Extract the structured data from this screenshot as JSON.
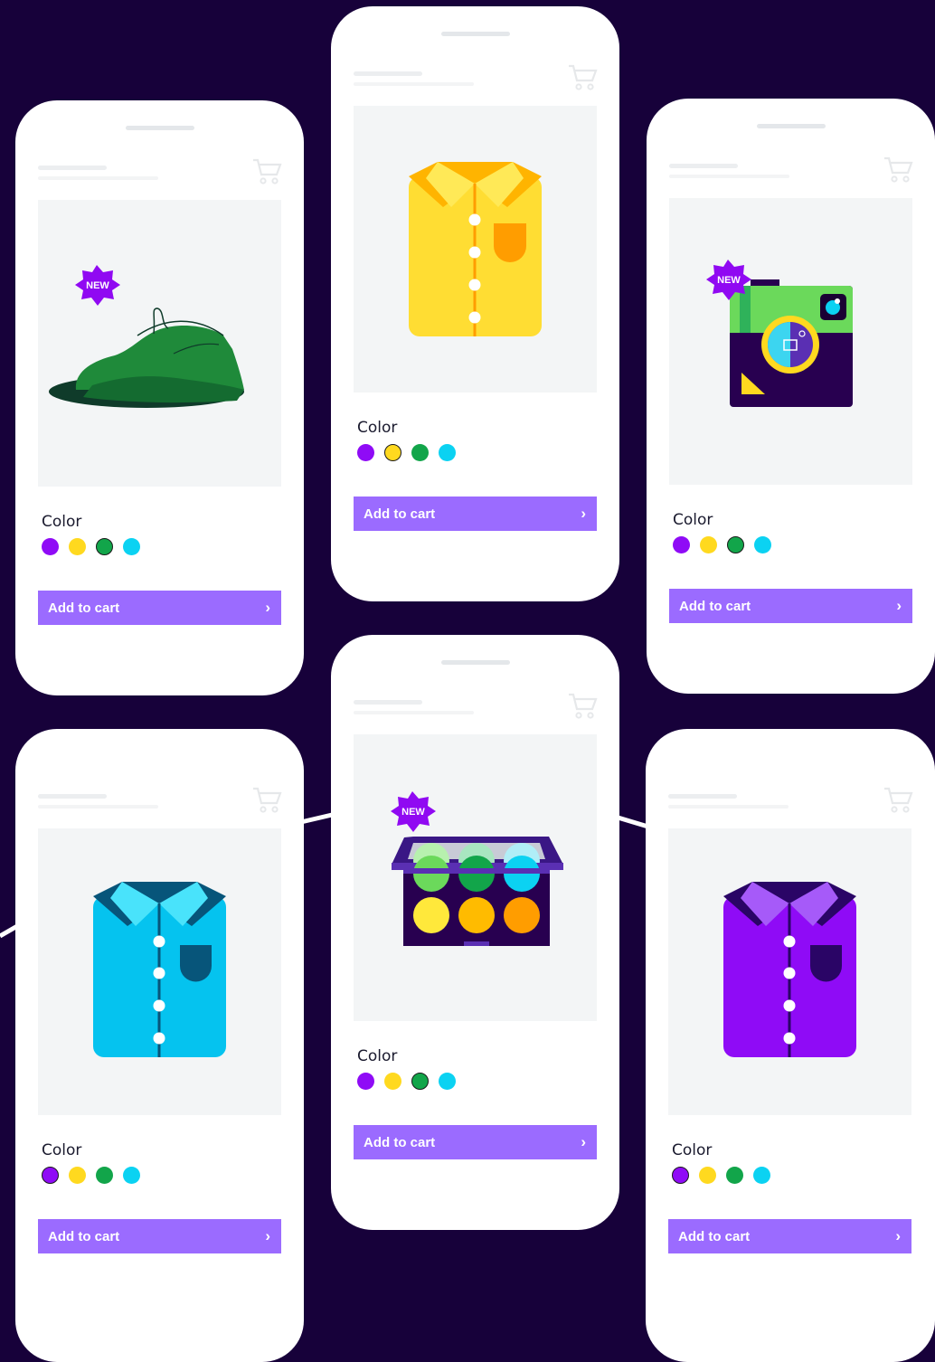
{
  "colors": {
    "background": "#17013a",
    "accent_button": "#9b6bff",
    "swatch_purple": "#8f0bf6",
    "swatch_yellow": "#ffd91f",
    "swatch_green": "#12a54a",
    "swatch_cyan": "#0bd2f2"
  },
  "products": [
    {
      "name": "green-sneaker",
      "badge": "NEW",
      "color_label": "Color",
      "selected_swatch": "green",
      "button_label": "Add to cart",
      "icon": "shoe-icon"
    },
    {
      "name": "yellow-shirt",
      "badge": "",
      "color_label": "Color",
      "selected_swatch": "yellow",
      "button_label": "Add to cart",
      "icon": "shirt-icon"
    },
    {
      "name": "camera",
      "badge": "NEW",
      "color_label": "Color",
      "selected_swatch": "green",
      "button_label": "Add to cart",
      "icon": "camera-icon"
    },
    {
      "name": "cyan-shirt",
      "badge": "",
      "color_label": "Color",
      "selected_swatch": "purple",
      "button_label": "Add to cart",
      "icon": "shirt-icon"
    },
    {
      "name": "eyeshadow-palette",
      "badge": "NEW",
      "color_label": "Color",
      "selected_swatch": "green",
      "button_label": "Add to cart",
      "icon": "palette-icon"
    },
    {
      "name": "purple-shirt",
      "badge": "",
      "color_label": "Color",
      "selected_swatch": "purple",
      "button_label": "Add to cart",
      "icon": "shirt-icon"
    }
  ],
  "swatch_order": [
    "purple",
    "yellow",
    "green",
    "cyan"
  ]
}
